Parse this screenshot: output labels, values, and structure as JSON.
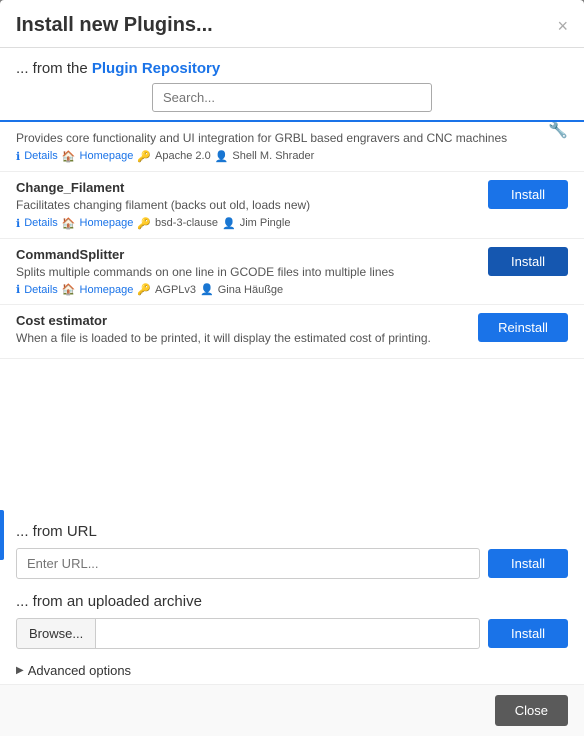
{
  "dialog": {
    "title": "Install new Plugins...",
    "close_label": "×"
  },
  "repo_section": {
    "prefix": "... from the ",
    "link_text": "Plugin Repository"
  },
  "search": {
    "placeholder": "Search..."
  },
  "plugins": [
    {
      "name": "",
      "desc": "Provides core functionality and UI integration for GRBL based engravers and CNC machines",
      "details": "Details",
      "homepage": "Homepage",
      "license": "Apache 2.0",
      "author": "Shell M. Shrader",
      "btn_label": null
    },
    {
      "name": "Change_Filament",
      "desc": "Facilitates changing filament (backs out old, loads new)",
      "details": "Details",
      "homepage": "Homepage",
      "license": "bsd-3-clause",
      "author": "Jim Pingle",
      "btn_label": "Install"
    },
    {
      "name": "CommandSplitter",
      "desc": "Splits multiple commands on one line in GCODE files into multiple lines",
      "details": "Details",
      "homepage": "Homepage",
      "license": "AGPLv3",
      "author": "Gina Häußge",
      "btn_label": "Install",
      "active": true
    },
    {
      "name": "Cost estimator",
      "desc": "When a file is loaded to be printed, it will display the estimated cost of printing.",
      "details": null,
      "homepage": null,
      "license": null,
      "author": null,
      "btn_label": "Reinstall"
    }
  ],
  "url_section": {
    "title": "... from URL",
    "placeholder": "Enter URL...",
    "btn_label": "Install"
  },
  "archive_section": {
    "title": "... from an uploaded archive",
    "browse_label": "Browse...",
    "btn_label": "Install"
  },
  "advanced": {
    "label": "Advanced options"
  },
  "footer": {
    "close_label": "Close"
  }
}
